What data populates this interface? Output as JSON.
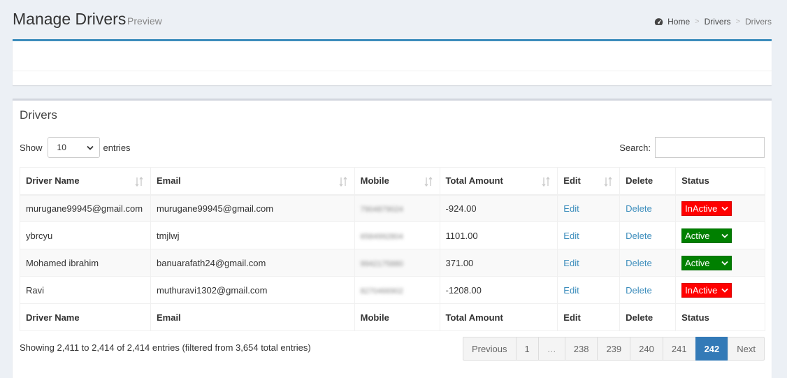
{
  "header": {
    "title": "Manage Drivers",
    "subtitle": "Preview",
    "breadcrumb": [
      "Home",
      "Drivers",
      "Drivers"
    ]
  },
  "box": {
    "title": "Drivers"
  },
  "controls": {
    "show_label": "Show",
    "entries_label": "entries",
    "page_length": "10",
    "search_label": "Search:",
    "search_value": ""
  },
  "table": {
    "columns": [
      "Driver Name",
      "Email",
      "Mobile",
      "Total Amount",
      "Edit",
      "Delete",
      "Status"
    ],
    "rows": [
      {
        "name": "murugane99945@gmail.com",
        "email": "murugane99945@gmail.com",
        "mobile": "7904879024",
        "amount": "-924.00",
        "edit": "Edit",
        "delete": "Delete",
        "status": "InActive"
      },
      {
        "name": "ybrcyu",
        "email": "tmjlwj",
        "mobile": "6584992804",
        "amount": "1101.00",
        "edit": "Edit",
        "delete": "Delete",
        "status": "Active"
      },
      {
        "name": "Mohamed ibrahim",
        "email": "banuarafath24@gmail.com",
        "mobile": "9942175880",
        "amount": "371.00",
        "edit": "Edit",
        "delete": "Delete",
        "status": "Active"
      },
      {
        "name": "Ravi",
        "email": "muthuravi1302@gmail.com",
        "mobile": "8270466902",
        "amount": "-1208.00",
        "edit": "Edit",
        "delete": "Delete",
        "status": "InActive"
      }
    ]
  },
  "status_colors": {
    "Active": "#008000",
    "InActive": "#ff0000"
  },
  "footer": {
    "info": "Showing 2,411 to 2,414 of 2,414 entries (filtered from 3,654 total entries)",
    "pages": [
      "Previous",
      "1",
      "…",
      "238",
      "239",
      "240",
      "241",
      "242",
      "Next"
    ],
    "active_page": "242"
  },
  "colors": {
    "accent": "#3c8dbc",
    "active_page": "#337ab7",
    "page_bg": "#ecf0f5"
  }
}
